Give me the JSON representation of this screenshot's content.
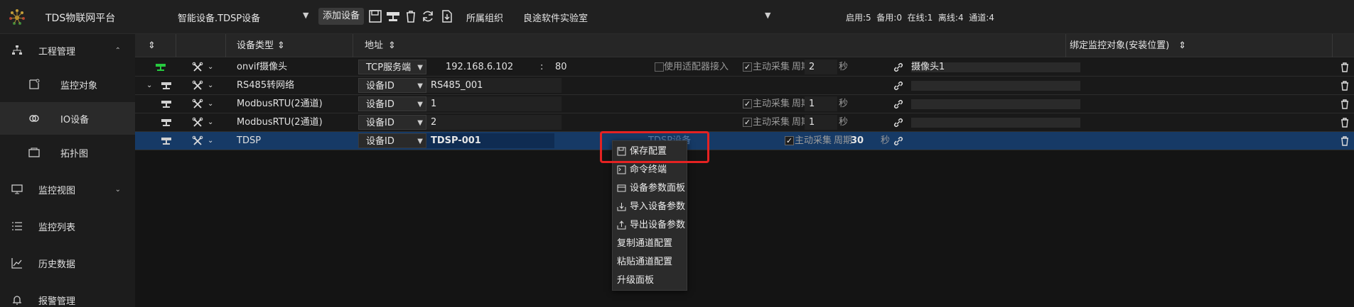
{
  "app": {
    "title": "TDS物联网平台"
  },
  "toolbar": {
    "device_select": "智能设备.TDSP设备",
    "add_device_label": "添加设备",
    "org_label": "所属组织",
    "org_select": "良途软件实验室",
    "status_summary": "启用:5  备用:0  在线:1  离线:4  通道:4"
  },
  "sidebar": {
    "items": [
      {
        "label": "工程管理",
        "icon": "sitemap-icon"
      },
      {
        "label": "监控对象",
        "icon": "monitor-object-icon"
      },
      {
        "label": "IO设备",
        "icon": "io-device-icon"
      },
      {
        "label": "拓扑图",
        "icon": "topology-icon"
      },
      {
        "label": "监控视图",
        "icon": "desktop-icon"
      },
      {
        "label": "监控列表",
        "icon": "list-icon"
      },
      {
        "label": "历史数据",
        "icon": "line-chart-icon"
      },
      {
        "label": "报警管理",
        "icon": "bell-icon"
      }
    ]
  },
  "table": {
    "headers": {
      "device_type": "设备类型",
      "address": "地址",
      "binding": "绑定监控对象(安装位置)"
    },
    "rows": [
      {
        "type": "onvif摄像头",
        "addr_type": "TCP服务端",
        "ip": "192.168.6.102",
        "colon": ":",
        "port": "80",
        "adapter_label": "使用适配器接入",
        "active_label": "主动采集",
        "period_label": "周期",
        "period": "2",
        "unit": "秒",
        "binding": "摄像头1",
        "status_color": "#27c93f"
      },
      {
        "type": "RS485转网络",
        "addr_type": "设备ID",
        "addr_value": "RS485_001",
        "binding": "",
        "status_color": "#d0d0d0"
      },
      {
        "type": "ModbusRTU(2通道)",
        "addr_type": "设备ID",
        "addr_value": "1",
        "active_label": "主动采集",
        "period_label": "周期",
        "period": "1",
        "unit": "秒",
        "binding": "",
        "status_color": "#d0d0d0"
      },
      {
        "type": "ModbusRTU(2通道)",
        "addr_type": "设备ID",
        "addr_value": "2",
        "active_label": "主动采集",
        "period_label": "周期",
        "period": "1",
        "unit": "秒",
        "binding": "",
        "status_color": "#d0d0d0"
      },
      {
        "type": "TDSP",
        "addr_type": "设备ID",
        "addr_value": "TDSP-001",
        "type_ghost": "TDSP设备",
        "active_label": "主动采集",
        "period_label": "周期",
        "period": "30",
        "unit": "秒",
        "binding": "",
        "status_color": "#d0d0d0"
      }
    ]
  },
  "context_menu": {
    "items": [
      {
        "label": "保存配置",
        "icon": "save-icon"
      },
      {
        "label": "命令终端",
        "icon": "terminal-icon"
      },
      {
        "label": "设备参数面板",
        "icon": "panel-icon"
      },
      {
        "label": "导入设备参数",
        "icon": "import-icon"
      },
      {
        "label": "导出设备参数",
        "icon": "export-icon"
      },
      {
        "label": "复制通道配置",
        "icon": ""
      },
      {
        "label": "粘贴通道配置",
        "icon": ""
      },
      {
        "label": "升级面板",
        "icon": ""
      }
    ]
  },
  "colors": {
    "selected_row": "#163a66",
    "highlight": "#e52222",
    "online": "#27c93f"
  }
}
